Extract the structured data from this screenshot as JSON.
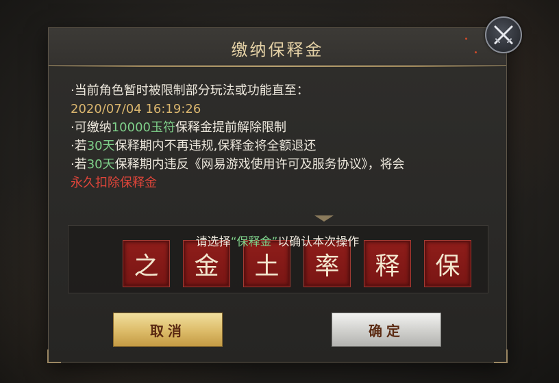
{
  "dialog": {
    "title": "缴纳保释金",
    "lines": [
      {
        "segments": [
          {
            "text": "·当前角色暂时被限制部分玩法或功能直至：",
            "style": "normal"
          }
        ]
      },
      {
        "segments": [
          {
            "text": "2020/07/04 16:19:26",
            "style": "gold"
          }
        ]
      },
      {
        "segments": [
          {
            "text": "·可缴纳",
            "style": "normal"
          },
          {
            "text": "10000玉符",
            "style": "green"
          },
          {
            "text": "保释金提前解除限制",
            "style": "normal"
          }
        ]
      },
      {
        "segments": [
          {
            "text": "·若",
            "style": "normal"
          },
          {
            "text": "30天",
            "style": "green"
          },
          {
            "text": "保释期内不再违规,保释金将全额退还",
            "style": "normal"
          }
        ]
      },
      {
        "segments": [
          {
            "text": "·若",
            "style": "normal"
          },
          {
            "text": "30天",
            "style": "green"
          },
          {
            "text": "保释期内违反《网易游戏使用许可及服务协议》，将会",
            "style": "normal"
          }
        ]
      },
      {
        "segments": [
          {
            "text": "永久扣除保释金",
            "style": "red"
          }
        ]
      }
    ],
    "prompt": {
      "before": "请选择",
      "highlight": "“保释金”",
      "after": "以确认本次操作"
    },
    "characters": [
      "之",
      "金",
      "土",
      "率",
      "释",
      "保"
    ],
    "cancel_label": "取消",
    "confirm_label": "确定"
  },
  "colors": {
    "accent_gold": "#d9b56e",
    "highlight_green": "#7fd08a",
    "warning_red": "#e0453a",
    "tile_red": "#8e1d1a"
  },
  "icons": {
    "close": "crossed-swords-icon"
  }
}
